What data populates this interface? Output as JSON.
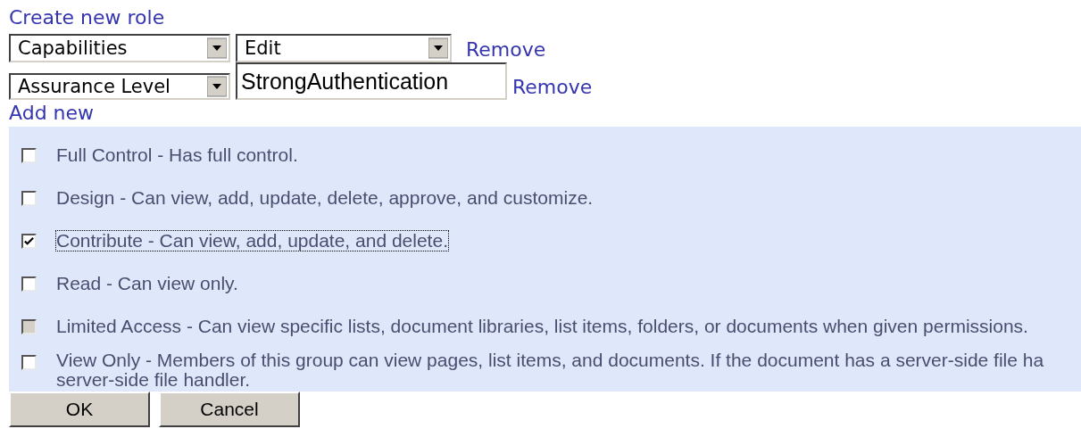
{
  "create_link": "Create new role",
  "conditions": [
    {
      "kind": "select",
      "field": "Capabilities",
      "value": "Edit",
      "remove": "Remove"
    },
    {
      "kind": "text",
      "field": "Assurance Level",
      "value": "StrongAuthentication",
      "remove": "Remove"
    }
  ],
  "add_link": "Add new",
  "permissions": [
    {
      "lines": [
        "Full Control - Has full control."
      ],
      "checked": false,
      "disabled": false,
      "focused": false
    },
    {
      "lines": [
        "Design - Can view, add, update, delete, approve, and customize."
      ],
      "checked": false,
      "disabled": false,
      "focused": false
    },
    {
      "lines": [
        "Contribute - Can view, add, update, and delete."
      ],
      "checked": true,
      "disabled": false,
      "focused": true
    },
    {
      "lines": [
        "Read - Can view only."
      ],
      "checked": false,
      "disabled": false,
      "focused": false
    },
    {
      "lines": [
        "Limited Access - Can view specific lists, document libraries, list items, folders, or documents when given permissions."
      ],
      "checked": false,
      "disabled": true,
      "focused": false
    },
    {
      "lines": [
        "View Only - Members of this group can view pages, list items, and documents. If the document has a server-side file ha",
        "server-side file handler."
      ],
      "checked": false,
      "disabled": false,
      "focused": false
    }
  ],
  "buttons": [
    "OK",
    "Cancel"
  ]
}
